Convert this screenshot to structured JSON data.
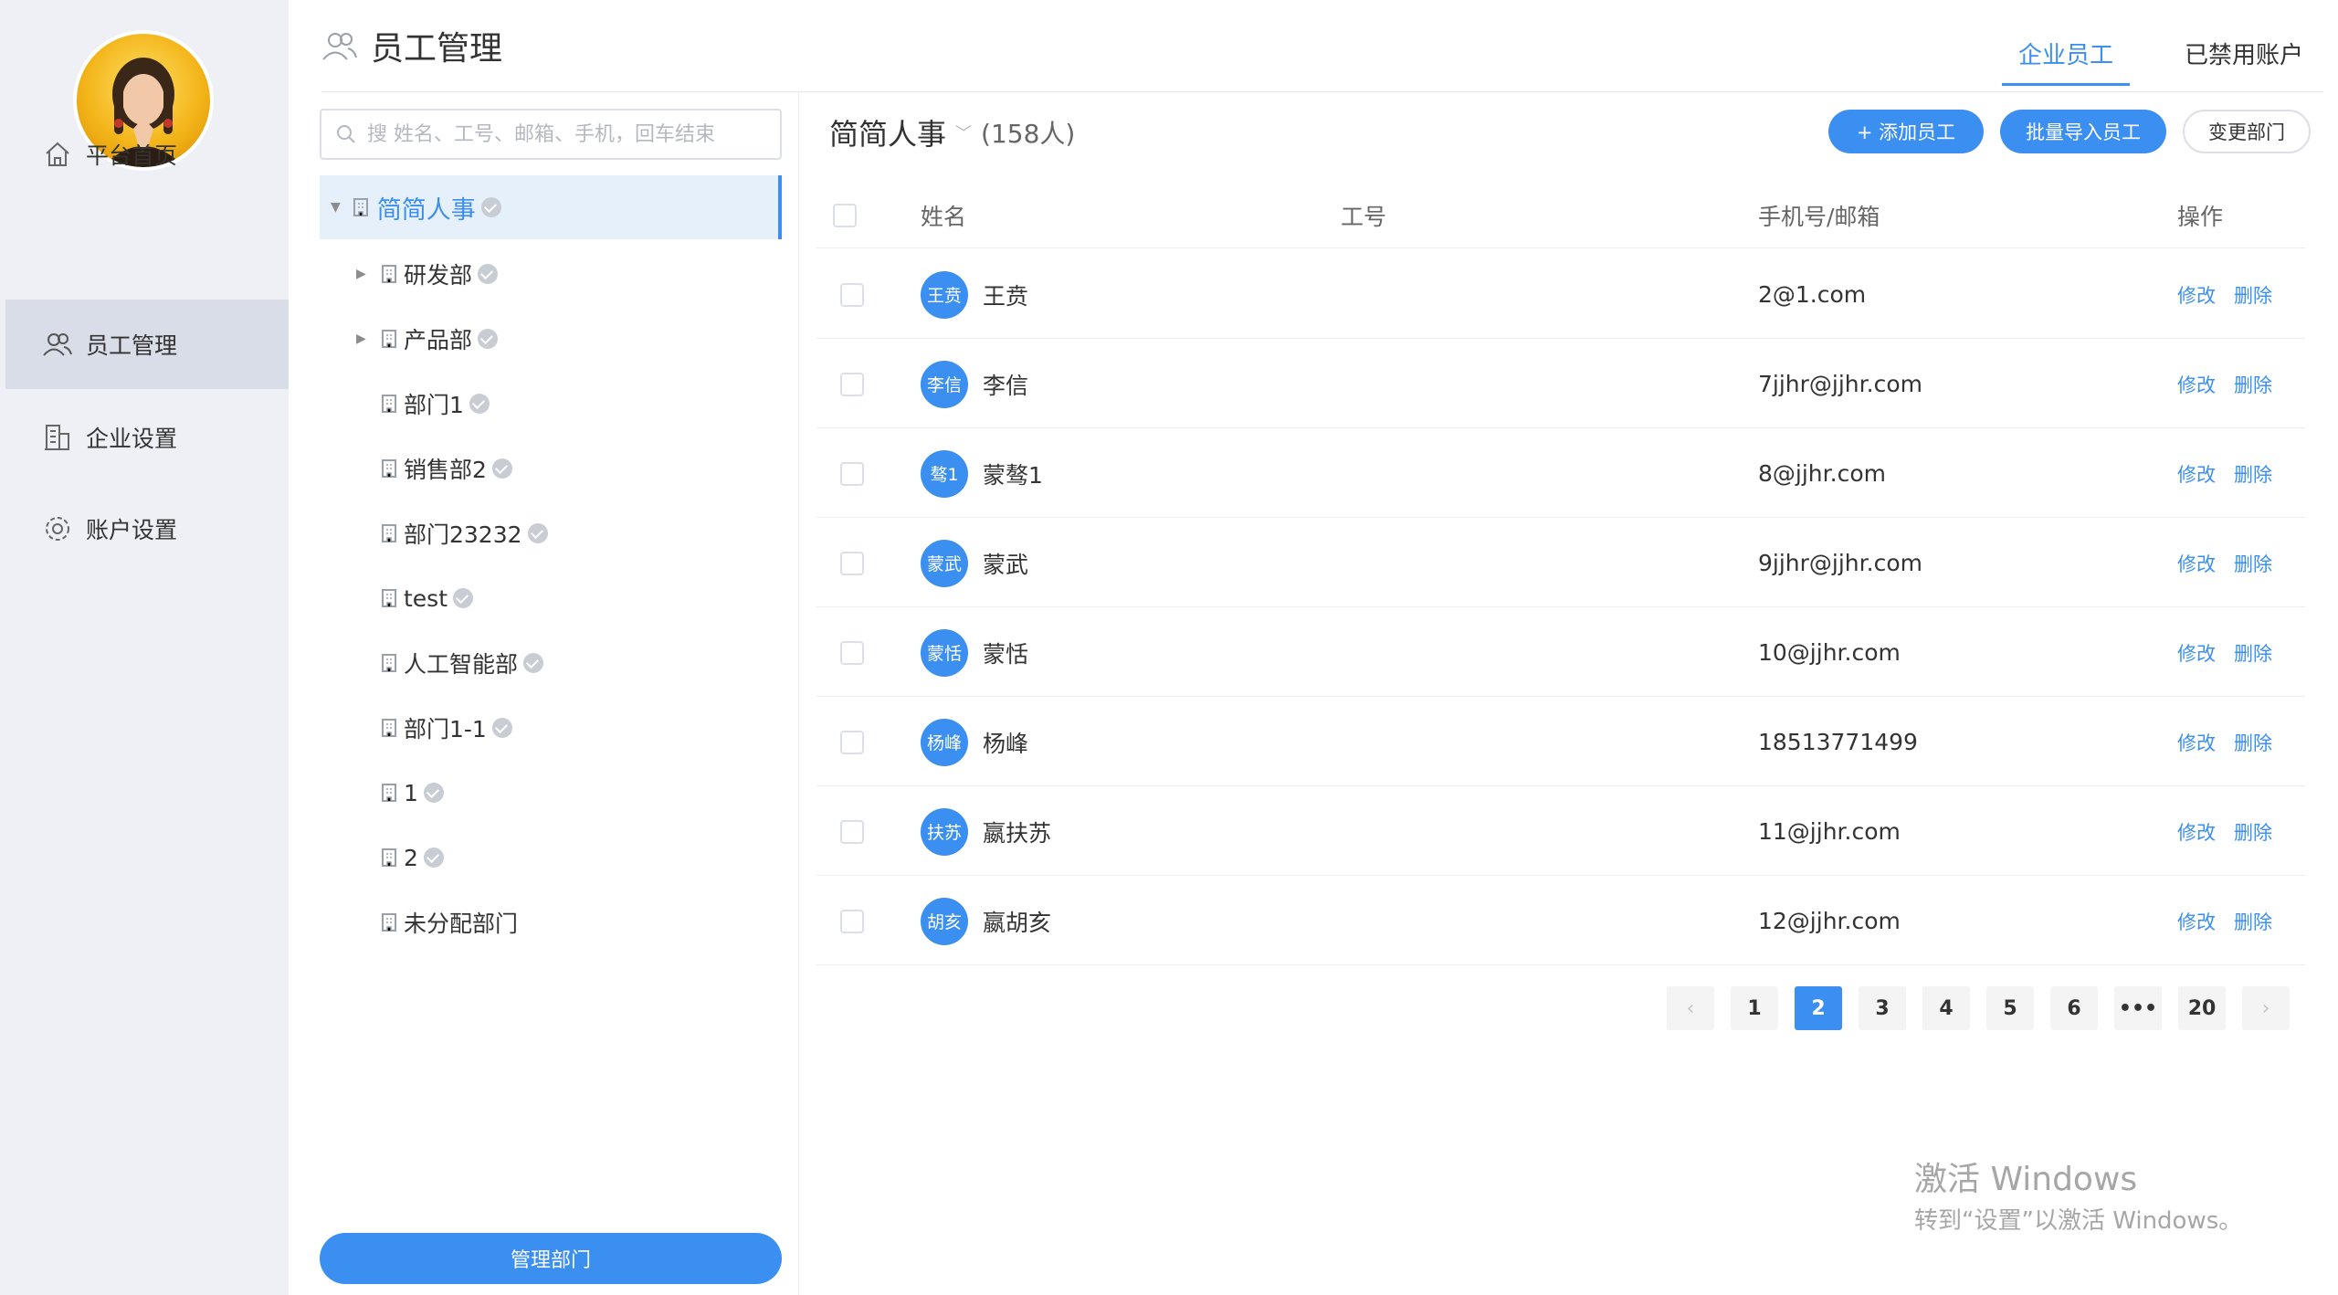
{
  "nav": {
    "items": [
      {
        "label": "平台首页",
        "icon": "home-icon"
      },
      {
        "label": "员工管理",
        "icon": "users-icon"
      },
      {
        "label": "企业设置",
        "icon": "building-icon"
      },
      {
        "label": "账户设置",
        "icon": "gear-icon"
      }
    ],
    "active_index": 1
  },
  "header": {
    "title": "员工管理",
    "tabs": [
      {
        "label": "企业员工",
        "active": true
      },
      {
        "label": "已禁用账户",
        "active": false
      }
    ]
  },
  "tree": {
    "search_placeholder": "搜 姓名、工号、邮箱、手机，回车结束",
    "root": "简简人事",
    "items": [
      {
        "label": "研发部",
        "expandable": true
      },
      {
        "label": "产品部",
        "expandable": true
      },
      {
        "label": "部门1",
        "expandable": false
      },
      {
        "label": "销售部2",
        "expandable": false
      },
      {
        "label": "部门23232",
        "expandable": false
      },
      {
        "label": "test",
        "expandable": false
      },
      {
        "label": "人工智能部",
        "expandable": false
      },
      {
        "label": "部门1-1",
        "expandable": false
      },
      {
        "label": "1",
        "expandable": false
      },
      {
        "label": "2",
        "expandable": false
      },
      {
        "label": "未分配部门",
        "expandable": false
      }
    ],
    "manage_button": "管理部门"
  },
  "main": {
    "dept_name": "简简人事",
    "count": "(158人)",
    "buttons": {
      "add": "+ 添加员工",
      "import": "批量导入员工",
      "change": "变更部门"
    },
    "columns": {
      "name": "姓名",
      "id": "工号",
      "contact": "手机号/邮箱",
      "action": "操作"
    },
    "rows": [
      {
        "avatar": "王贲",
        "name": "王贲",
        "emp_id": "",
        "contact": "2@1.com"
      },
      {
        "avatar": "李信",
        "name": "李信",
        "emp_id": "",
        "contact": "7jjhr@jjhr.com"
      },
      {
        "avatar": "骜1",
        "name": "蒙骜1",
        "emp_id": "",
        "contact": "8@jjhr.com"
      },
      {
        "avatar": "蒙武",
        "name": "蒙武",
        "emp_id": "",
        "contact": "9jjhr@jjhr.com"
      },
      {
        "avatar": "蒙恬",
        "name": "蒙恬",
        "emp_id": "",
        "contact": "10@jjhr.com"
      },
      {
        "avatar": "杨峰",
        "name": "杨峰",
        "emp_id": "",
        "contact": "18513771499"
      },
      {
        "avatar": "扶苏",
        "name": "嬴扶苏",
        "emp_id": "",
        "contact": "11@jjhr.com"
      },
      {
        "avatar": "胡亥",
        "name": "嬴胡亥",
        "emp_id": "",
        "contact": "12@jjhr.com"
      }
    ],
    "row_actions": {
      "edit": "修改",
      "delete": "删除"
    }
  },
  "pagination": {
    "prev": "‹",
    "next": "›",
    "pages": [
      "1",
      "2",
      "3",
      "4",
      "5",
      "6",
      "•••",
      "20"
    ],
    "current": "2"
  },
  "watermark": {
    "line1": "激活 Windows",
    "line2": "转到“设置”以激活 Windows。"
  },
  "colors": {
    "accent": "#3b8ff0",
    "sidebar_bg": "#eef0f5",
    "sidebar_active": "#d9dde7"
  }
}
